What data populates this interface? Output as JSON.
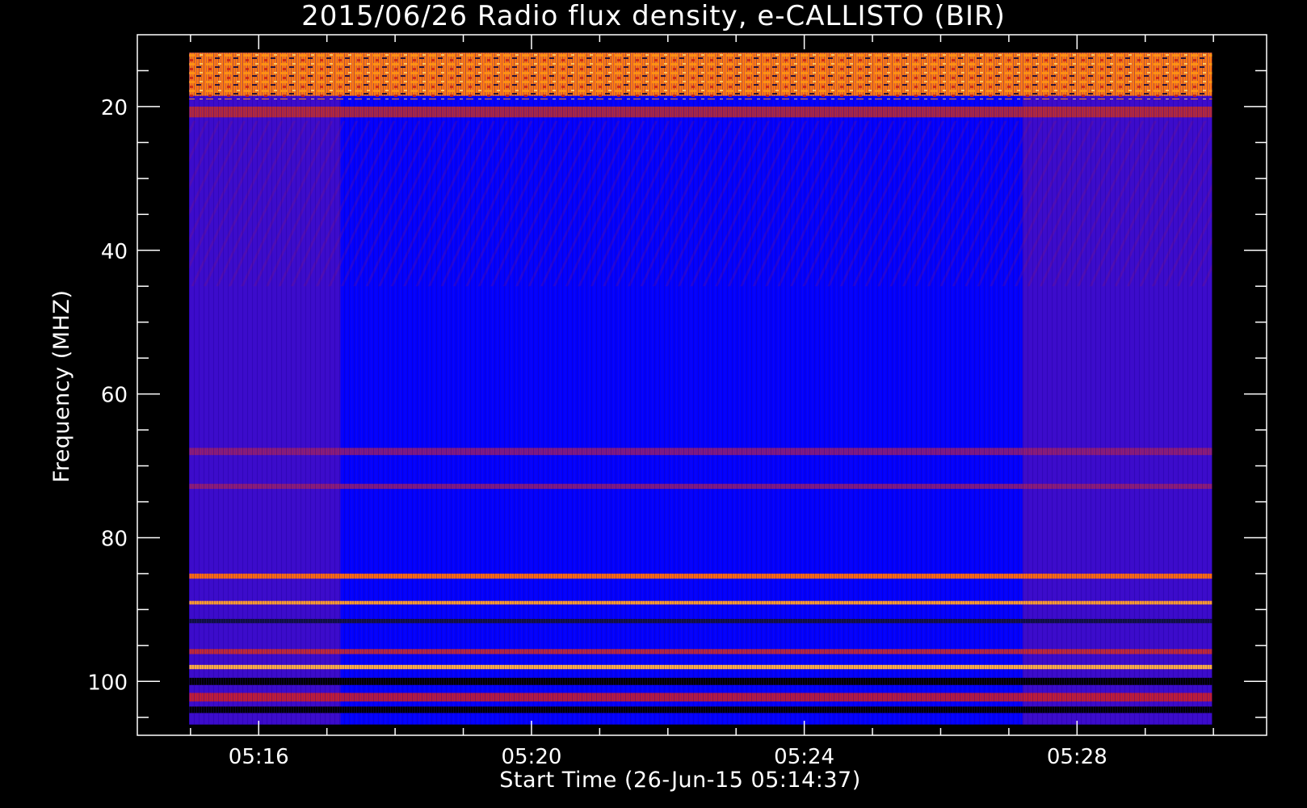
{
  "chart_data": {
    "type": "heatmap",
    "title": "2015/06/26  Radio flux density, e-CALLISTO (BIR)",
    "xlabel": "Start Time (26-Jun-15 05:14:37)",
    "ylabel": "Frequency (MHZ)",
    "x_tick_labels": [
      "05:16",
      "05:20",
      "05:24",
      "05:28"
    ],
    "y_tick_labels": [
      "20",
      "40",
      "60",
      "80",
      "100"
    ],
    "x_major_minutes": [
      16,
      20,
      24,
      28
    ],
    "x_range_minutes": [
      14.22,
      30.78
    ],
    "x_data_range_minutes": [
      14.98,
      29.98
    ],
    "y_major": [
      20,
      40,
      60,
      80,
      100
    ],
    "ylim": [
      10,
      107.5
    ],
    "y_data_range": [
      12.5,
      106
    ],
    "background_color": "#0000ff",
    "segments": [
      {
        "name": "",
        "start": 14.98,
        "end": 17.2,
        "level": "moderate"
      },
      {
        "name": "",
        "start": 17.2,
        "end": 27.2,
        "level": "low"
      },
      {
        "name": "",
        "start": 27.2,
        "end": 29.98,
        "level": "moderate"
      }
    ],
    "bands": [
      {
        "from": 12.5,
        "to": 18.5,
        "intensity": "high",
        "color": "#ff7a10"
      },
      {
        "from": 20,
        "to": 21.5,
        "intensity": "medium",
        "color": "#d03018"
      },
      {
        "from": 67.5,
        "to": 68.5,
        "intensity": "medium",
        "color": "#a02060"
      },
      {
        "from": 72.5,
        "to": 73.2,
        "intensity": "medium",
        "color": "#a02060"
      },
      {
        "from": 85,
        "to": 85.7,
        "intensity": "high",
        "color": "#ff6a10"
      },
      {
        "from": 88.8,
        "to": 89.3,
        "intensity": "high",
        "color": "#ff9a30"
      },
      {
        "from": 91.3,
        "to": 91.9,
        "intensity": "low",
        "color": "#101040"
      },
      {
        "from": 95.5,
        "to": 96.2,
        "intensity": "medium",
        "color": "#e03010"
      },
      {
        "from": 97.7,
        "to": 98.3,
        "intensity": "high",
        "color": "#ffb040"
      },
      {
        "from": 99.5,
        "to": 100.5,
        "intensity": "low",
        "color": "#000000"
      },
      {
        "from": 101.6,
        "to": 102.8,
        "intensity": "medium",
        "color": "#e02010"
      },
      {
        "from": 103.5,
        "to": 104.4,
        "intensity": "low",
        "color": "#000000"
      }
    ]
  }
}
